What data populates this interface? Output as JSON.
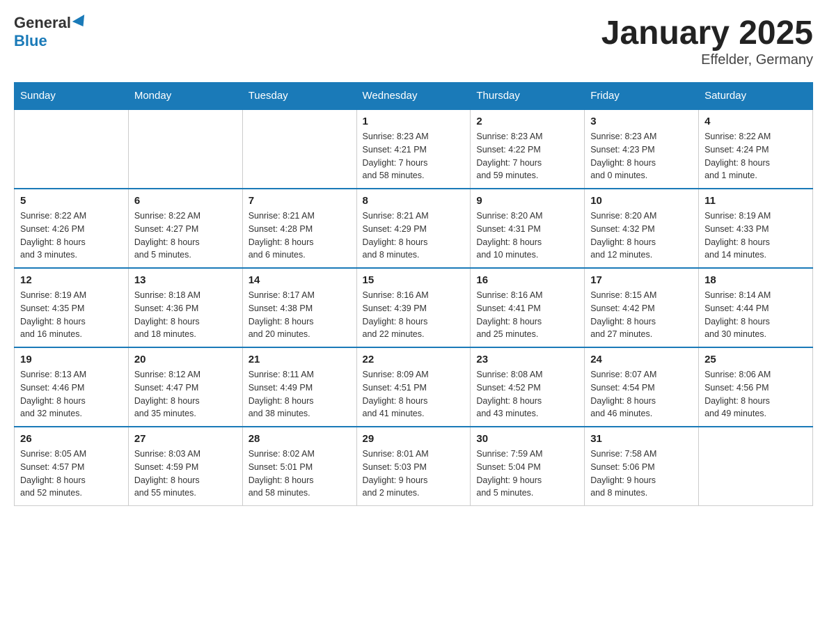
{
  "header": {
    "logo_general": "General",
    "logo_blue": "Blue",
    "title": "January 2025",
    "subtitle": "Effelder, Germany"
  },
  "calendar": {
    "days_of_week": [
      "Sunday",
      "Monday",
      "Tuesday",
      "Wednesday",
      "Thursday",
      "Friday",
      "Saturday"
    ],
    "weeks": [
      [
        {
          "day": null,
          "info": null
        },
        {
          "day": null,
          "info": null
        },
        {
          "day": null,
          "info": null
        },
        {
          "day": "1",
          "info": "Sunrise: 8:23 AM\nSunset: 4:21 PM\nDaylight: 7 hours\nand 58 minutes."
        },
        {
          "day": "2",
          "info": "Sunrise: 8:23 AM\nSunset: 4:22 PM\nDaylight: 7 hours\nand 59 minutes."
        },
        {
          "day": "3",
          "info": "Sunrise: 8:23 AM\nSunset: 4:23 PM\nDaylight: 8 hours\nand 0 minutes."
        },
        {
          "day": "4",
          "info": "Sunrise: 8:22 AM\nSunset: 4:24 PM\nDaylight: 8 hours\nand 1 minute."
        }
      ],
      [
        {
          "day": "5",
          "info": "Sunrise: 8:22 AM\nSunset: 4:26 PM\nDaylight: 8 hours\nand 3 minutes."
        },
        {
          "day": "6",
          "info": "Sunrise: 8:22 AM\nSunset: 4:27 PM\nDaylight: 8 hours\nand 5 minutes."
        },
        {
          "day": "7",
          "info": "Sunrise: 8:21 AM\nSunset: 4:28 PM\nDaylight: 8 hours\nand 6 minutes."
        },
        {
          "day": "8",
          "info": "Sunrise: 8:21 AM\nSunset: 4:29 PM\nDaylight: 8 hours\nand 8 minutes."
        },
        {
          "day": "9",
          "info": "Sunrise: 8:20 AM\nSunset: 4:31 PM\nDaylight: 8 hours\nand 10 minutes."
        },
        {
          "day": "10",
          "info": "Sunrise: 8:20 AM\nSunset: 4:32 PM\nDaylight: 8 hours\nand 12 minutes."
        },
        {
          "day": "11",
          "info": "Sunrise: 8:19 AM\nSunset: 4:33 PM\nDaylight: 8 hours\nand 14 minutes."
        }
      ],
      [
        {
          "day": "12",
          "info": "Sunrise: 8:19 AM\nSunset: 4:35 PM\nDaylight: 8 hours\nand 16 minutes."
        },
        {
          "day": "13",
          "info": "Sunrise: 8:18 AM\nSunset: 4:36 PM\nDaylight: 8 hours\nand 18 minutes."
        },
        {
          "day": "14",
          "info": "Sunrise: 8:17 AM\nSunset: 4:38 PM\nDaylight: 8 hours\nand 20 minutes."
        },
        {
          "day": "15",
          "info": "Sunrise: 8:16 AM\nSunset: 4:39 PM\nDaylight: 8 hours\nand 22 minutes."
        },
        {
          "day": "16",
          "info": "Sunrise: 8:16 AM\nSunset: 4:41 PM\nDaylight: 8 hours\nand 25 minutes."
        },
        {
          "day": "17",
          "info": "Sunrise: 8:15 AM\nSunset: 4:42 PM\nDaylight: 8 hours\nand 27 minutes."
        },
        {
          "day": "18",
          "info": "Sunrise: 8:14 AM\nSunset: 4:44 PM\nDaylight: 8 hours\nand 30 minutes."
        }
      ],
      [
        {
          "day": "19",
          "info": "Sunrise: 8:13 AM\nSunset: 4:46 PM\nDaylight: 8 hours\nand 32 minutes."
        },
        {
          "day": "20",
          "info": "Sunrise: 8:12 AM\nSunset: 4:47 PM\nDaylight: 8 hours\nand 35 minutes."
        },
        {
          "day": "21",
          "info": "Sunrise: 8:11 AM\nSunset: 4:49 PM\nDaylight: 8 hours\nand 38 minutes."
        },
        {
          "day": "22",
          "info": "Sunrise: 8:09 AM\nSunset: 4:51 PM\nDaylight: 8 hours\nand 41 minutes."
        },
        {
          "day": "23",
          "info": "Sunrise: 8:08 AM\nSunset: 4:52 PM\nDaylight: 8 hours\nand 43 minutes."
        },
        {
          "day": "24",
          "info": "Sunrise: 8:07 AM\nSunset: 4:54 PM\nDaylight: 8 hours\nand 46 minutes."
        },
        {
          "day": "25",
          "info": "Sunrise: 8:06 AM\nSunset: 4:56 PM\nDaylight: 8 hours\nand 49 minutes."
        }
      ],
      [
        {
          "day": "26",
          "info": "Sunrise: 8:05 AM\nSunset: 4:57 PM\nDaylight: 8 hours\nand 52 minutes."
        },
        {
          "day": "27",
          "info": "Sunrise: 8:03 AM\nSunset: 4:59 PM\nDaylight: 8 hours\nand 55 minutes."
        },
        {
          "day": "28",
          "info": "Sunrise: 8:02 AM\nSunset: 5:01 PM\nDaylight: 8 hours\nand 58 minutes."
        },
        {
          "day": "29",
          "info": "Sunrise: 8:01 AM\nSunset: 5:03 PM\nDaylight: 9 hours\nand 2 minutes."
        },
        {
          "day": "30",
          "info": "Sunrise: 7:59 AM\nSunset: 5:04 PM\nDaylight: 9 hours\nand 5 minutes."
        },
        {
          "day": "31",
          "info": "Sunrise: 7:58 AM\nSunset: 5:06 PM\nDaylight: 9 hours\nand 8 minutes."
        },
        {
          "day": null,
          "info": null
        }
      ]
    ]
  }
}
